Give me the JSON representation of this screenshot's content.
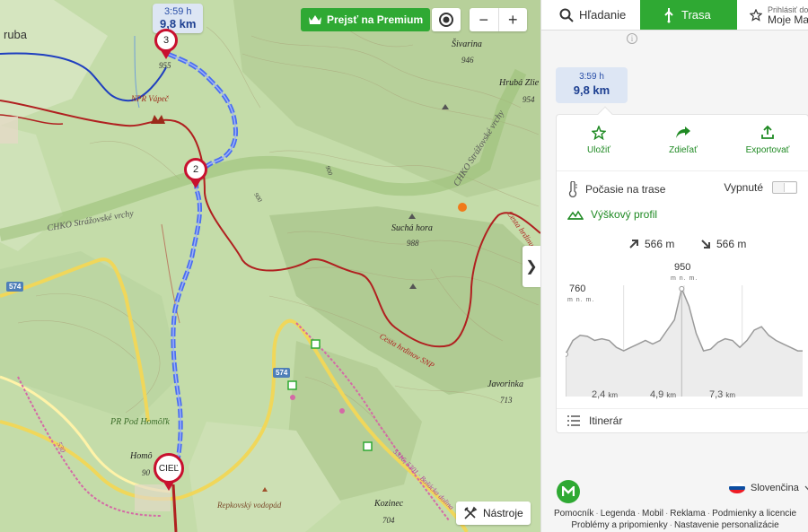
{
  "colors": {
    "accent_green": "#2fa933",
    "route_blue": "#3f63e0",
    "trail_red": "#b02020",
    "marker_red": "#c8102e"
  },
  "map": {
    "places": {
      "hruba": "ruba",
      "sivarina_name": "Šivarina",
      "sivarina_alt": "946",
      "hruba_zlieb_name": "Hrubá Zlie",
      "hruba_zlieb_alt": "954",
      "npr_vapec": "NPR Vápeč",
      "vapec_alt": "955",
      "chko_left": "CHKO Strážovské vrchy",
      "chko_right": "CHKO Strážovské vrchy",
      "sucha_hora_name": "Suchá hora",
      "sucha_hora_alt": "988",
      "cesta_snp_1": "Cesta hrdinov SNP",
      "cesta_snp_2": "Cesta hrdinu",
      "javorinka_name": "Javorinka",
      "javorinka_alt": "713",
      "pr_pod_homolkou": "PR Pod Homôľk",
      "homol_name": "Homô",
      "homol_alt": "90",
      "repkovsky": "Repkovský vodopád",
      "kozinec_name": "Kozinec",
      "kozinec_alt": "704",
      "trail_code": "5316, 5301 · Bošácka dolina",
      "trail_code_left": "530",
      "road_574_a": "574",
      "road_574_b": "574",
      "contour_900_a": "900",
      "contour_900_b": "900"
    },
    "route_tooltip": {
      "time": "3:59 h",
      "distance": "9,8 km"
    },
    "markers": {
      "m3": "3",
      "m2": "2",
      "finish": "CIEĽ"
    },
    "premium_label": "Prejsť na Premium",
    "zoom_minus": "−",
    "zoom_plus": "+",
    "tools_label": "Nástroje",
    "collapse_glyph": "❯"
  },
  "panel": {
    "tabs": {
      "search": "Hľadanie",
      "route": "Trasa",
      "login_line1": "Prihlásiť do",
      "login_line2": "Moje Ma"
    },
    "summary": {
      "time": "3:59 h",
      "distance": "9,8 km"
    },
    "actions": {
      "save": "Uložiť",
      "share": "Zdieľať",
      "export": "Exportovať"
    },
    "weather_label": "Počasie na trase",
    "weather_toggle": "Vypnuté",
    "elevation_title": "Výškový profil",
    "ascent": "566 m",
    "descent": "566 m",
    "profile": {
      "min_label": "760",
      "max_label": "950",
      "unit": "m n. m.",
      "ticks": [
        {
          "value": "2,4",
          "unit": "km"
        },
        {
          "value": "4,9",
          "unit": "km"
        },
        {
          "value": "7,3",
          "unit": "km"
        }
      ],
      "distances_km": [
        0,
        0.3,
        0.6,
        0.9,
        1.2,
        1.5,
        1.8,
        2.1,
        2.4,
        2.7,
        3.0,
        3.3,
        3.6,
        3.9,
        4.2,
        4.5,
        4.8,
        5.1,
        5.4,
        5.7,
        6.0,
        6.3,
        6.6,
        6.9,
        7.2,
        7.5,
        7.8,
        8.1,
        8.4,
        8.7,
        9.0,
        9.3,
        9.6,
        9.8
      ],
      "elevations_m": [
        760,
        800,
        815,
        812,
        800,
        805,
        800,
        780,
        770,
        780,
        790,
        800,
        790,
        800,
        830,
        860,
        950,
        900,
        820,
        770,
        775,
        795,
        805,
        800,
        780,
        800,
        830,
        840,
        815,
        800,
        790,
        780,
        770,
        770
      ]
    },
    "itinerary": "Itinerár",
    "language": "Slovenčina",
    "footer_links": [
      "Pomocník",
      "Legenda",
      "Mobil",
      "Reklama",
      "Podmienky a licencie",
      "Problémy a pripomienky",
      "Nastavenie personalizácie"
    ]
  }
}
